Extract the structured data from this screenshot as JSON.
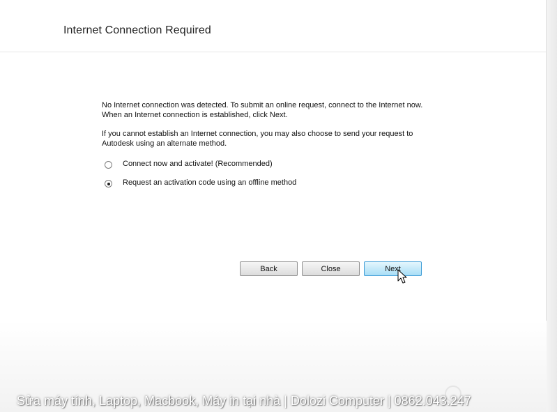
{
  "dialog": {
    "title": "Internet Connection Required",
    "paragraph1_line1": "No Internet connection was detected. To submit an online request, connect to the Internet now.",
    "paragraph1_line2": "When an Internet connection is established, click Next.",
    "paragraph2_line1": "If you cannot establish an Internet connection, you may also choose to send your request to",
    "paragraph2_line2": "Autodesk using an alternate method.",
    "options": [
      {
        "label": "Connect now and activate! (Recommended)",
        "selected": false
      },
      {
        "label": "Request an activation code using an offline method",
        "selected": true
      }
    ],
    "buttons": {
      "back": "Back",
      "close": "Close",
      "next": "Next"
    }
  },
  "overlay": {
    "watermark": "Sửa máy tính, Laptop, Macbook, Máy in tại nhà | Dolozi Computer | 0862.043.247"
  },
  "colors": {
    "next_button_fill": "#a8def6",
    "next_button_border": "#3c9bd6"
  },
  "icons": [
    "mouse-pointer-icon"
  ]
}
